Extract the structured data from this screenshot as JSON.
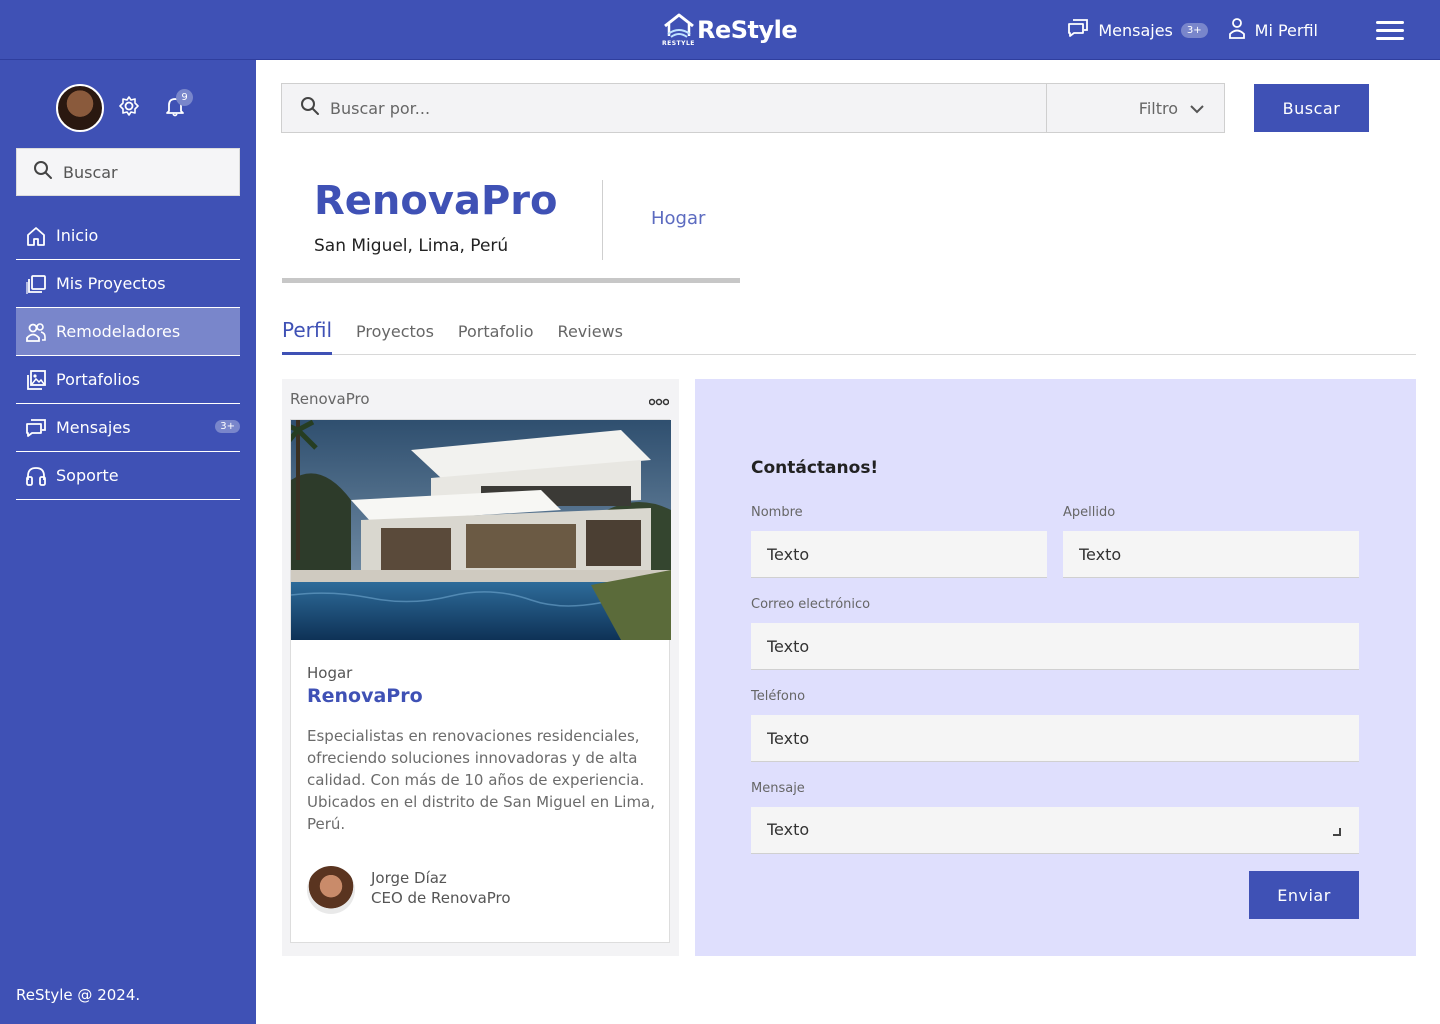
{
  "brand": {
    "logo_text": "ReStyle",
    "logo_sub": "RESTYLE",
    "color": "#3f51b5",
    "accent": "#7986cb"
  },
  "topbar": {
    "messages_label": "Mensajes",
    "messages_badge": "3+",
    "profile_label": "Mi Perfil",
    "icons": [
      "chat-icon",
      "user-icon",
      "menu-icon"
    ]
  },
  "sidebar": {
    "notification_count": "9",
    "search_placeholder": "Buscar",
    "items": [
      {
        "label": "Inicio",
        "icon": "home-icon"
      },
      {
        "label": "Mis Proyectos",
        "icon": "folders-icon"
      },
      {
        "label": "Remodeladores",
        "icon": "users-icon",
        "active": true
      },
      {
        "label": "Portafolios",
        "icon": "gallery-icon"
      },
      {
        "label": "Mensajes",
        "icon": "chat-icon",
        "badge": "3+"
      },
      {
        "label": "Soporte",
        "icon": "headset-icon"
      }
    ],
    "footer": "ReStyle @ 2024."
  },
  "search": {
    "placeholder": "Buscar por...",
    "filter_label": "Filtro",
    "button_label": "Buscar"
  },
  "company": {
    "name": "RenovaPro",
    "location": "San Miguel, Lima, Perú",
    "category": "Hogar"
  },
  "tabs": [
    {
      "label": "Perfil",
      "active": true
    },
    {
      "label": "Proyectos"
    },
    {
      "label": "Portafolio"
    },
    {
      "label": "Reviews"
    }
  ],
  "card": {
    "header": "RenovaPro",
    "category": "Hogar",
    "title": "RenovaPro",
    "description": "Especialistas en renovaciones residenciales, ofreciendo soluciones innovadoras y de alta calidad. Con más de 10 años de experiencia. Ubicados en el distrito de San Miguel en Lima, Perú.",
    "person_name": "Jorge Díaz",
    "person_role": "CEO de RenovaPro"
  },
  "contact": {
    "title": "Contáctanos!",
    "first_name_label": "Nombre",
    "last_name_label": "Apellido",
    "email_label": "Correo electrónico",
    "phone_label": "Teléfono",
    "message_label": "Mensaje",
    "placeholder": "Texto",
    "submit_label": "Enviar"
  }
}
